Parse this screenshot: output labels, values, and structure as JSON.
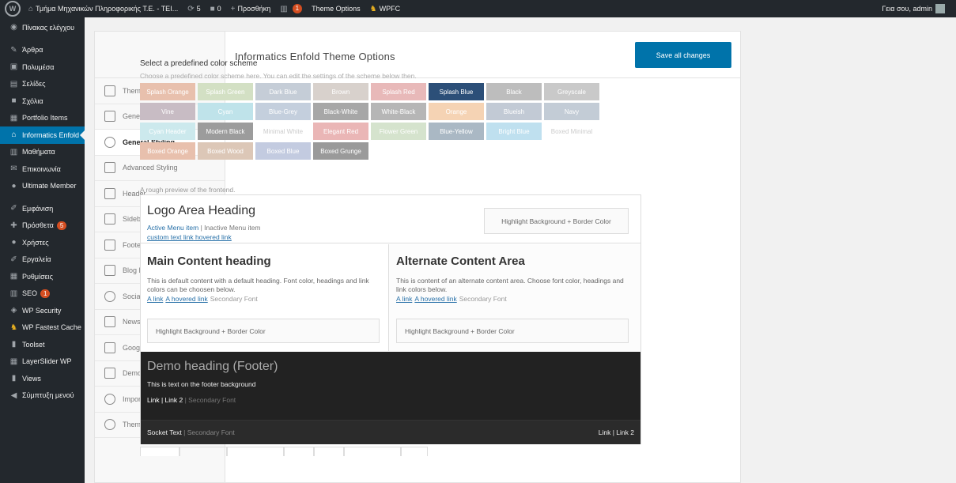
{
  "adminbar": {
    "site_name": "Τμήμα Μηχανικών Πληροφορικής Τ.Ε. - ΤΕΙ...",
    "updates_count": "5",
    "comments_count": "0",
    "new_label": "Προσθήκη",
    "seo_count": "1",
    "theme_options": "Theme Options",
    "wpfc": "WPFC",
    "greeting": "Γεια σου, admin"
  },
  "admin_menu": [
    {
      "label": "Πίνακας ελέγχου",
      "icon": "dashboard-icon"
    },
    {
      "label": "Άρθρα",
      "icon": "pin-icon"
    },
    {
      "label": "Πολυμέσα",
      "icon": "media-icon"
    },
    {
      "label": "Σελίδες",
      "icon": "page-icon"
    },
    {
      "label": "Σχόλια",
      "icon": "comment-icon"
    },
    {
      "label": "Portfolio Items",
      "icon": "portfolio-icon"
    },
    {
      "label": "Informatics Enfold",
      "icon": "home-icon"
    },
    {
      "label": "Μαθήματα",
      "icon": "book-icon"
    },
    {
      "label": "Επικοινωνία",
      "icon": "mail-icon"
    },
    {
      "label": "Ultimate Member",
      "icon": "user-icon"
    },
    {
      "label": "Εμφάνιση",
      "icon": "brush-icon"
    },
    {
      "label": "Πρόσθετα",
      "icon": "plugin-icon",
      "count": "5"
    },
    {
      "label": "Χρήστες",
      "icon": "users-icon"
    },
    {
      "label": "Εργαλεία",
      "icon": "wrench-icon"
    },
    {
      "label": "Ρυθμίσεις",
      "icon": "settings-icon"
    },
    {
      "label": "SEO",
      "icon": "seo-icon",
      "count": "1"
    },
    {
      "label": "WP Security",
      "icon": "shield-icon"
    },
    {
      "label": "WP Fastest Cache",
      "icon": "cheetah-icon"
    },
    {
      "label": "Toolset",
      "icon": "toolset-icon"
    },
    {
      "label": "LayerSlider WP",
      "icon": "layers-icon"
    },
    {
      "label": "Views",
      "icon": "views-icon"
    },
    {
      "label": "Σύμπτυξη μενού",
      "icon": "collapse-icon"
    }
  ],
  "panel": {
    "title": "Informatics Enfold Theme Options",
    "save_label": "Save all changes",
    "tabs": [
      {
        "label": "Theme Options",
        "icon": "tools-icon"
      },
      {
        "label": "General Layout",
        "icon": "layout-icon"
      },
      {
        "label": "General Styling",
        "icon": "palette-icon"
      },
      {
        "label": "Advanced Styling",
        "icon": "magic-wand-icon"
      },
      {
        "label": "Header",
        "icon": "header-icon"
      },
      {
        "label": "Sidebar Settings",
        "icon": "sidebar-icon"
      },
      {
        "label": "Footer",
        "icon": "footer-icon"
      },
      {
        "label": "Blog Layout",
        "icon": "blog-icon"
      },
      {
        "label": "Social Profiles",
        "icon": "social-icon"
      },
      {
        "label": "Newsletter",
        "icon": "newsletter-icon"
      },
      {
        "label": "Google Services",
        "icon": "google-icon"
      },
      {
        "label": "Demo Import",
        "icon": "import-icon"
      },
      {
        "label": "Import/Export",
        "icon": "import-export-icon"
      },
      {
        "label": "Theme Update",
        "icon": "refresh-icon"
      }
    ]
  },
  "color_scheme": {
    "title": "Select a predefined color scheme",
    "description": "Choose a predefined color scheme here. You can edit the settings of the scheme below then.",
    "swatches": [
      {
        "label": "Splash Orange",
        "color": "#e8c0ad",
        "text": "#fff"
      },
      {
        "label": "Splash Green",
        "color": "#d3e0c4",
        "text": "#fff"
      },
      {
        "label": "Dark Blue",
        "color": "#c5cdd7",
        "text": "#fff"
      },
      {
        "label": "Brown",
        "color": "#d8d1cc",
        "text": "#fff"
      },
      {
        "label": "Splash Red",
        "color": "#e8b9b9",
        "text": "#fff"
      },
      {
        "label": "Splash Blue",
        "color": "#2c4f78",
        "text": "#fff"
      },
      {
        "label": "Black",
        "color": "#bdbdbd",
        "text": "#fff"
      },
      {
        "label": "Greyscale",
        "color": "#c9c9c9",
        "text": "#fff"
      },
      {
        "label": "Vine",
        "color": "#c8bcc4",
        "text": "#fff"
      },
      {
        "label": "Cyan",
        "color": "#bfe3ea",
        "text": "#fff"
      },
      {
        "label": "Blue-Grey",
        "color": "#c4cfdd",
        "text": "#fff"
      },
      {
        "label": "Black-White",
        "color": "#a7a7a7",
        "text": "#fff"
      },
      {
        "label": "White-Black",
        "color": "#b6b6b6",
        "text": "#fff"
      },
      {
        "label": "Orange",
        "color": "#f5d3b4",
        "text": "#fff"
      },
      {
        "label": "Blueish",
        "color": "#c2cad5",
        "text": "#fff"
      },
      {
        "label": "Navy",
        "color": "#c3ccd6",
        "text": "#fff"
      },
      {
        "label": "Cyan Header",
        "color": "#cce9ed",
        "text": "#fff"
      },
      {
        "label": "Modern Black",
        "color": "#9c9c9c",
        "text": "#fff"
      },
      {
        "label": "Minimal White",
        "color": "#ffffff",
        "text": "#ccc"
      },
      {
        "label": "Elegant Red",
        "color": "#eab6b6",
        "text": "#fff"
      },
      {
        "label": "Flower Green",
        "color": "#d5e3cd",
        "text": "#fff"
      },
      {
        "label": "Blue-Yellow",
        "color": "#aab8c4",
        "text": "#fff"
      },
      {
        "label": "Bright Blue",
        "color": "#bfe0ef",
        "text": "#fff"
      },
      {
        "label": "Boxed Minimal",
        "color": "#ffffff",
        "text": "#ccc"
      },
      {
        "label": "Boxed Orange",
        "color": "#e8c0ad",
        "text": "#fff"
      },
      {
        "label": "Boxed Wood",
        "color": "#dcc7b7",
        "text": "#fff"
      },
      {
        "label": "Boxed Blue",
        "color": "#c3cbe0",
        "text": "#fff"
      },
      {
        "label": "Boxed Grunge",
        "color": "#9a9a9a",
        "text": "#fff"
      }
    ]
  },
  "preview": {
    "label": "A rough preview of the frontend.",
    "logo_heading": "Logo Area Heading",
    "active_menu": "Active Menu item",
    "separator": "|",
    "inactive_menu": "Inactive Menu item",
    "custom_link": "custom text link",
    "hovered_link": "hovered link",
    "highlight": "Highlight Background + Border Color",
    "main_heading": "Main Content heading",
    "main_text": "This is default content with a default heading. Font color, headings and link colors can be choosen below.",
    "alt_heading": "Alternate Content Area",
    "alt_text": "This is content of an alternate content area. Choose font color, headings and link colors below.",
    "a_link": "A link",
    "a_hovered_link": "A hovered link",
    "secondary_font": "Secondary Font",
    "footer_heading": "Demo heading (Footer)",
    "footer_text": "This is text on the footer background",
    "footer_links": "Link | Link 2",
    "footer_secondary": "| Secondary Font",
    "socket_text": "Socket Text",
    "socket_secondary": "| Secondary Font",
    "socket_links": "Link | Link 2"
  }
}
